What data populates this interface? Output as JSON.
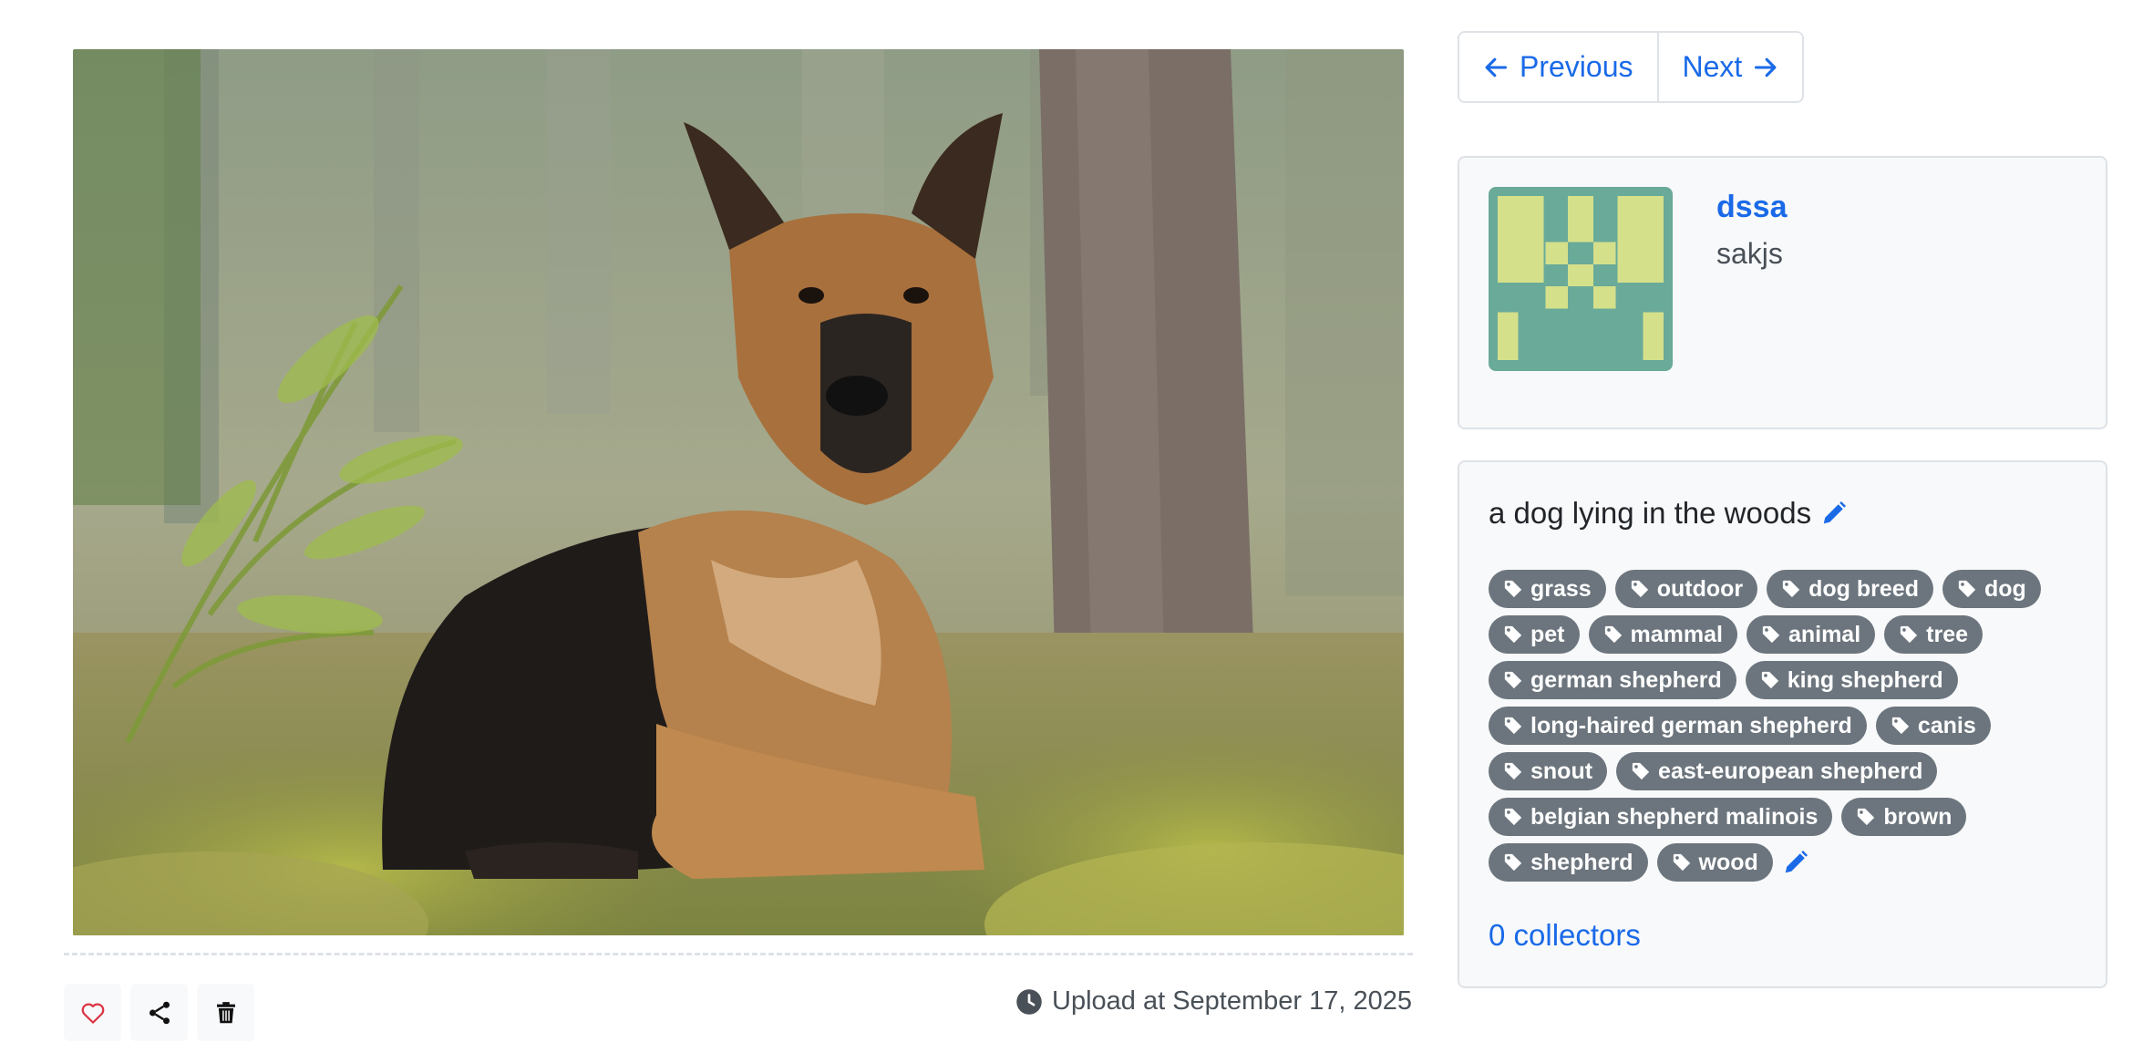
{
  "nav": {
    "previous_label": "Previous",
    "next_label": "Next"
  },
  "user": {
    "name": "dssa",
    "handle": "sakjs"
  },
  "photo": {
    "caption": "a dog lying in the woods",
    "tags": [
      "grass",
      "outdoor",
      "dog breed",
      "dog",
      "pet",
      "mammal",
      "animal",
      "tree",
      "german shepherd",
      "king shepherd",
      "long-haired german shepherd",
      "canis",
      "snout",
      "east-european shepherd",
      "belgian shepherd malinois",
      "brown",
      "shepherd",
      "wood"
    ],
    "collectors_label": "0 collectors",
    "upload_label": "Upload at September 17, 2025"
  },
  "icons": {
    "previous": "arrow-left-icon",
    "next": "arrow-right-icon",
    "like": "heart-icon",
    "share": "share-icon",
    "delete": "trash-icon",
    "clock": "clock-icon",
    "edit": "pencil-icon",
    "tag": "tag-icon"
  },
  "colors": {
    "link": "#1a6ae8",
    "tag_bg": "#6c757d",
    "like": "#dc3545",
    "avatar_bg": "#6aaa99",
    "avatar_fg": "#d5e08a"
  }
}
